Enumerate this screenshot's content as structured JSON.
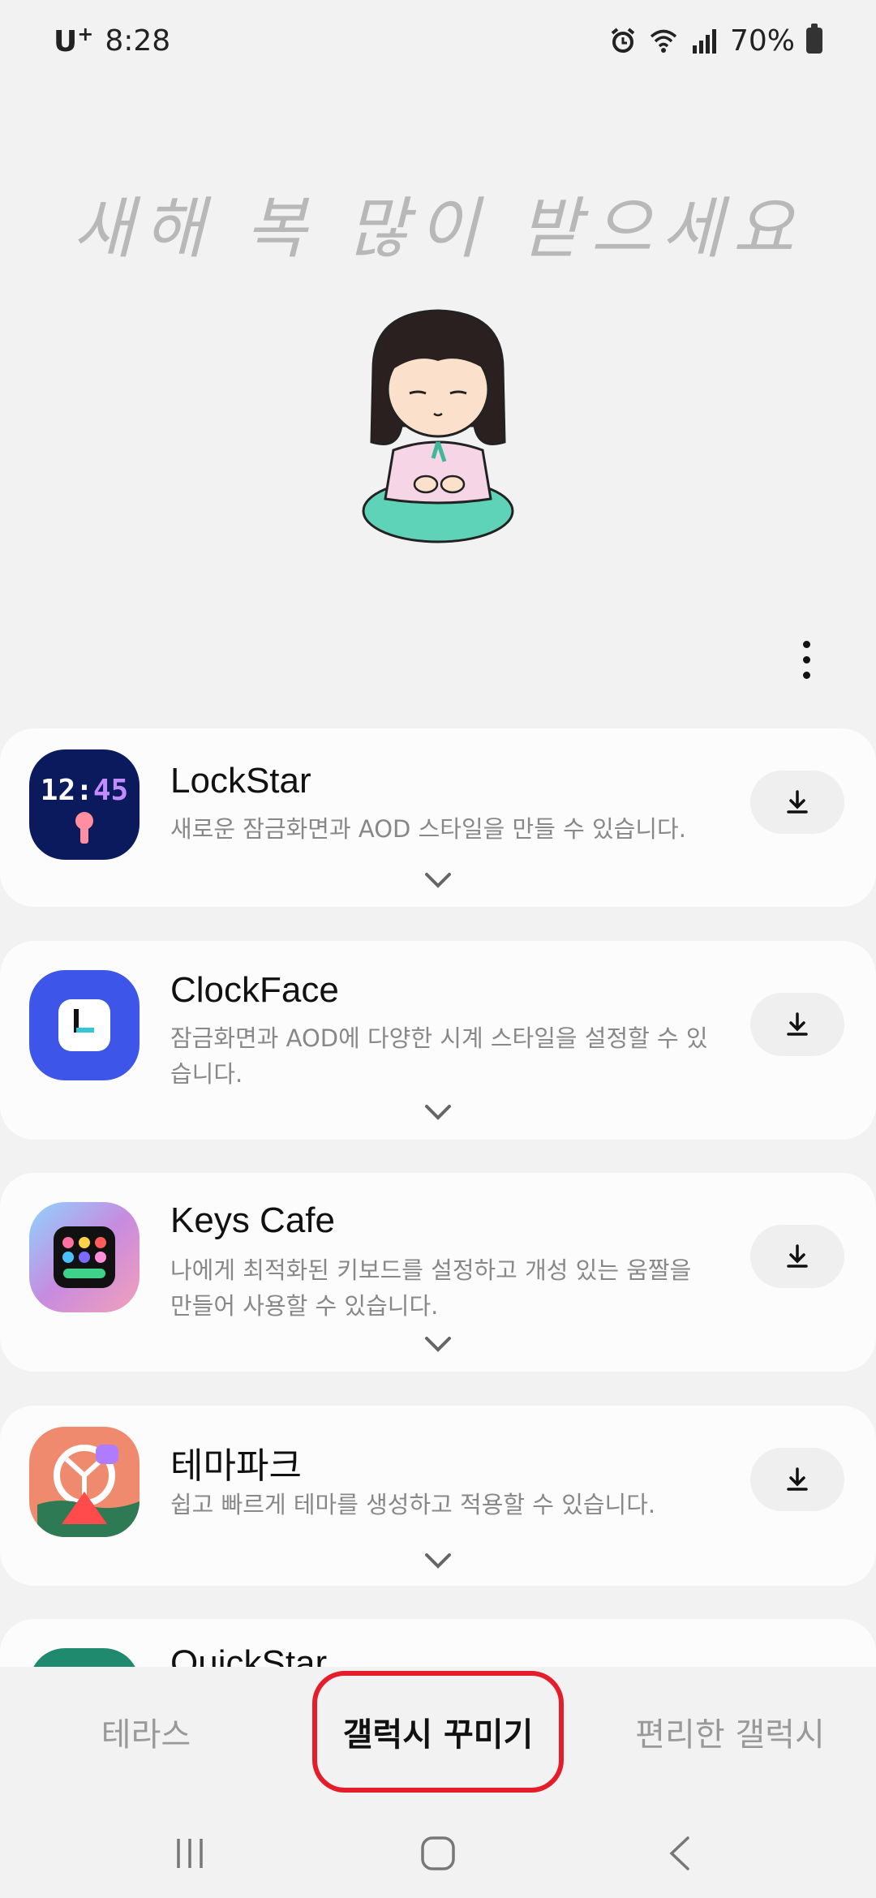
{
  "status_bar": {
    "carrier": "U",
    "carrier_sup": "+",
    "time": "8:28",
    "battery": "70%",
    "icons": [
      "alarm-icon",
      "wifi-icon",
      "signal-icon",
      "battery-icon"
    ]
  },
  "header": {
    "greeting": "새해 복 많이 받으세요"
  },
  "apps": [
    {
      "title": "LockStar",
      "desc": "새로운 잠금화면과 AOD 스타일을 만들 수 있습니다.",
      "icon_text": "12:45",
      "icon_bg": "#0a1a5c"
    },
    {
      "title": "ClockFace",
      "desc": "잠금화면과 AOD에 다양한 시계 스타일을 설정할 수 있습니다.",
      "icon_bg": "#3d55e8"
    },
    {
      "title": "Keys Cafe",
      "desc": "나에게 최적화된 키보드를 설정하고 개성 있는 움짤을 만들어 사용할 수 있습니다.",
      "icon_bg": "#c78be0"
    },
    {
      "title": "테마파크",
      "desc": "쉽고 빠르게 테마를 생성하고 적용할 수 있습니다.",
      "icon_bg": "#f08a6e"
    },
    {
      "title": "QuickStar",
      "desc": "",
      "icon_bg": "#1f8a6e"
    }
  ],
  "tabs": [
    {
      "label": "테라스"
    },
    {
      "label": "갤럭시 꾸미기"
    },
    {
      "label": "편리한 갤럭시"
    }
  ],
  "colors": {
    "highlight": "#e51d2a",
    "accent_text": "#111111",
    "muted_text": "#888888"
  }
}
